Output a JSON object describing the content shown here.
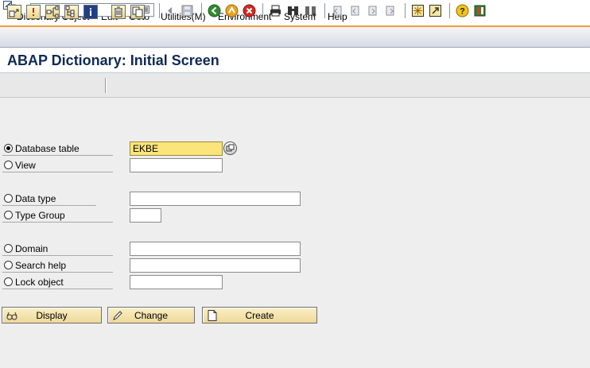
{
  "menu": {
    "items": [
      "Dictionary Object",
      "Edit",
      "Goto",
      "Utilities(M)",
      "Environment",
      "System",
      "Help"
    ]
  },
  "toolbar": {
    "command_field_value": "",
    "icons": [
      "enter-icon",
      "back-icon",
      "exit-icon",
      "cancel-icon",
      "print-icon",
      "find-icon",
      "find-next-icon",
      "first-page-icon",
      "previous-page-icon",
      "next-page-icon",
      "last-page-icon",
      "create-session-icon",
      "create-shortcut-icon",
      "help-icon",
      "customize-layout-icon"
    ]
  },
  "title": "ABAP Dictionary: Initial Screen",
  "app_toolbar": {
    "icons": [
      "other-object-icon",
      "check-icon",
      "where-used-icon",
      "hierarchy-icon",
      "info-icon",
      "delete-icon",
      "copy-icon"
    ]
  },
  "form": {
    "database_table": {
      "label": "Database table",
      "value": "EKBE",
      "selected": true
    },
    "view": {
      "label": "View",
      "value": ""
    },
    "data_type": {
      "label": "Data type",
      "value": ""
    },
    "type_group": {
      "label": "Type Group",
      "value": ""
    },
    "domain": {
      "label": "Domain",
      "value": ""
    },
    "search_help": {
      "label": "Search help",
      "value": ""
    },
    "lock_object": {
      "label": "Lock object",
      "value": ""
    }
  },
  "buttons": {
    "display": "Display",
    "change": "Change",
    "create": "Create"
  },
  "colors": {
    "title": "#0f2a57",
    "active_field": "#fbe47a",
    "toolbar_accent": "#f0a040"
  }
}
